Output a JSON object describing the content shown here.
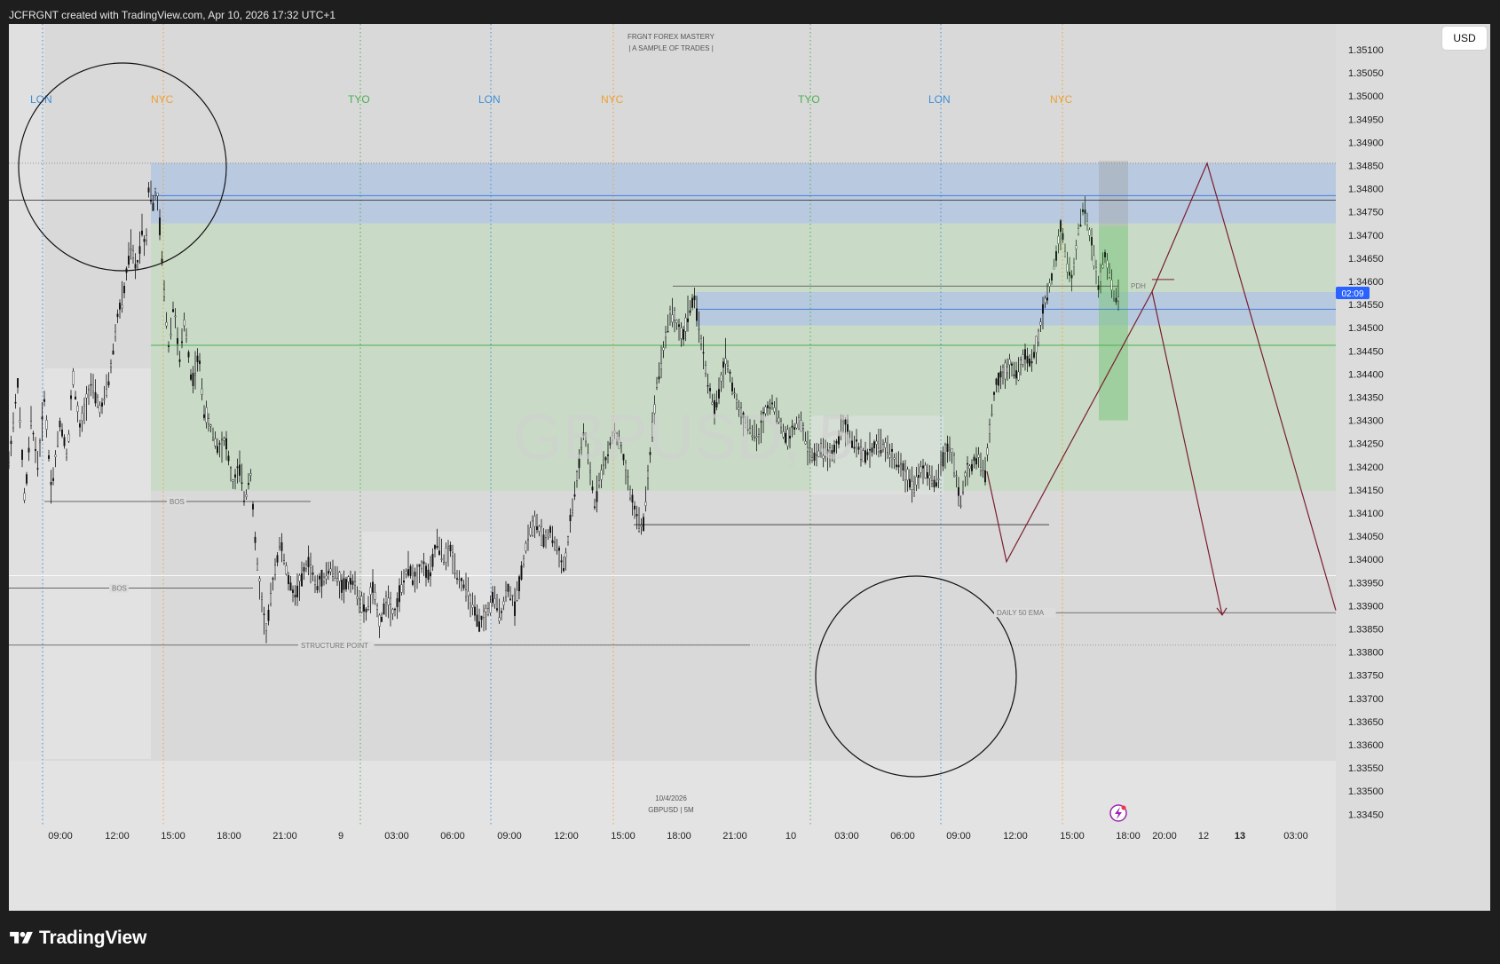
{
  "header": {
    "title": "JCFRGNT created with TradingView.com, Apr 10, 2026 17:32 UTC+1"
  },
  "currency": {
    "label": "USD"
  },
  "footer": {
    "brand": "TradingView"
  },
  "chart_data": {
    "type": "candlestick",
    "symbol_watermark": "GBPUSD, 5",
    "top_caption": [
      "FRGNT FOREX MASTERY",
      "|  A SAMPLE OF TRADES |"
    ],
    "bottom_caption": [
      "10/4/2026",
      "GBPUSD | 5M"
    ],
    "y_ticks": [
      "1.35100",
      "1.35050",
      "1.35000",
      "1.34950",
      "1.34900",
      "1.34850",
      "1.34800",
      "1.34750",
      "1.34700",
      "1.34650",
      "1.34600",
      "1.34550",
      "1.34500",
      "1.34450",
      "1.34400",
      "1.34350",
      "1.34300",
      "1.34250",
      "1.34200",
      "1.34150",
      "1.34100",
      "1.34050",
      "1.34000",
      "1.33950",
      "1.33900",
      "1.33850",
      "1.33800",
      "1.33750",
      "1.33700",
      "1.33650",
      "1.33600",
      "1.33550",
      "1.33500",
      "1.33450"
    ],
    "ylim": [
      1.3343,
      1.3511
    ],
    "price_marker": {
      "label": "02:09",
      "price": 1.34575,
      "color": "#2962ff"
    },
    "x_ticks": [
      {
        "label": "09:00",
        "bold": false
      },
      {
        "label": "12:00",
        "bold": false
      },
      {
        "label": "15:00",
        "bold": false
      },
      {
        "label": "18:00",
        "bold": false
      },
      {
        "label": "21:00",
        "bold": false
      },
      {
        "label": "9",
        "bold": false
      },
      {
        "label": "03:00",
        "bold": false
      },
      {
        "label": "06:00",
        "bold": false
      },
      {
        "label": "09:00",
        "bold": false
      },
      {
        "label": "12:00",
        "bold": false
      },
      {
        "label": "15:00",
        "bold": false
      },
      {
        "label": "18:00",
        "bold": false
      },
      {
        "label": "21:00",
        "bold": false
      },
      {
        "label": "10",
        "bold": false
      },
      {
        "label": "03:00",
        "bold": false
      },
      {
        "label": "06:00",
        "bold": false
      },
      {
        "label": "09:00",
        "bold": false
      },
      {
        "label": "12:00",
        "bold": false
      },
      {
        "label": "15:00",
        "bold": false
      },
      {
        "label": "18:00",
        "bold": false
      },
      {
        "label": "20:00",
        "bold": false
      },
      {
        "label": "12",
        "bold": false
      },
      {
        "label": "13",
        "bold": true
      },
      {
        "label": "03:00",
        "bold": false
      }
    ],
    "sessions": [
      {
        "label": "LON",
        "color": "#3d8fd6"
      },
      {
        "label": "NYC",
        "color": "#f0a030"
      },
      {
        "label": "TYO",
        "color": "#4caf50"
      },
      {
        "label": "LON",
        "color": "#3d8fd6"
      },
      {
        "label": "NYC",
        "color": "#f0a030"
      },
      {
        "label": "TYO",
        "color": "#4caf50"
      },
      {
        "label": "LON",
        "color": "#3d8fd6"
      },
      {
        "label": "NYC",
        "color": "#f0a030"
      }
    ],
    "annotations": [
      {
        "label": "BOS",
        "price": 1.34125
      },
      {
        "label": "BOS",
        "price": 1.33938
      },
      {
        "label": "STRUCTURE POINT",
        "price": 1.33815
      },
      {
        "label": "PDH",
        "price": 1.3459
      },
      {
        "label": "DAILY 50 EMA",
        "price": 1.33885
      }
    ],
    "zones": [
      {
        "name": "supply-zone",
        "top": 1.34855,
        "bottom": 1.34725,
        "color": "#b5c7e0"
      },
      {
        "name": "profit-zone",
        "top": 1.34725,
        "bottom": 1.34148,
        "color": "#c5dbc3"
      },
      {
        "name": "demand-zone",
        "top": 1.34577,
        "bottom": 1.34505,
        "color": "#b5c7e0"
      }
    ],
    "projection": {
      "color": "#7a1e2e",
      "path_prices": [
        1.3419,
        1.33995,
        1.34578,
        1.34855,
        1.3389
      ],
      "arrow_prices": [
        1.34578,
        1.3388
      ]
    },
    "price_path": [
      [
        0,
        1.3421
      ],
      [
        10,
        1.3438
      ],
      [
        18,
        1.3412
      ],
      [
        25,
        1.343
      ],
      [
        33,
        1.342
      ],
      [
        40,
        1.3435
      ],
      [
        48,
        1.3415
      ],
      [
        58,
        1.343
      ],
      [
        66,
        1.3422
      ],
      [
        72,
        1.344
      ],
      [
        80,
        1.3428
      ],
      [
        92,
        1.3438
      ],
      [
        104,
        1.3432
      ],
      [
        114,
        1.344
      ],
      [
        122,
        1.3452
      ],
      [
        130,
        1.3458
      ],
      [
        137,
        1.3468
      ],
      [
        144,
        1.3462
      ],
      [
        150,
        1.3472
      ],
      [
        154,
        1.3466
      ],
      [
        158,
        1.3482
      ],
      [
        162,
        1.3476
      ],
      [
        166,
        1.348
      ],
      [
        170,
        1.3472
      ],
      [
        174,
        1.346
      ],
      [
        180,
        1.3446
      ],
      [
        186,
        1.3456
      ],
      [
        192,
        1.3442
      ],
      [
        198,
        1.3452
      ],
      [
        206,
        1.3438
      ],
      [
        214,
        1.3444
      ],
      [
        220,
        1.3432
      ],
      [
        228,
        1.3428
      ],
      [
        236,
        1.3424
      ],
      [
        244,
        1.3426
      ],
      [
        252,
        1.3416
      ],
      [
        260,
        1.342
      ],
      [
        266,
        1.3412
      ],
      [
        272,
        1.342
      ],
      [
        278,
        1.3402
      ],
      [
        284,
        1.3392
      ],
      [
        290,
        1.3384
      ],
      [
        298,
        1.3396
      ],
      [
        306,
        1.3404
      ],
      [
        314,
        1.3396
      ],
      [
        322,
        1.3392
      ],
      [
        330,
        1.3396
      ],
      [
        338,
        1.34
      ],
      [
        346,
        1.3394
      ],
      [
        354,
        1.3396
      ],
      [
        362,
        1.3398
      ],
      [
        370,
        1.3396
      ],
      [
        378,
        1.3394
      ],
      [
        386,
        1.3396
      ],
      [
        394,
        1.3392
      ],
      [
        402,
        1.3388
      ],
      [
        410,
        1.3394
      ],
      [
        418,
        1.3386
      ],
      [
        426,
        1.3392
      ],
      [
        434,
        1.3388
      ],
      [
        442,
        1.3394
      ],
      [
        450,
        1.3398
      ],
      [
        458,
        1.3396
      ],
      [
        466,
        1.3399
      ],
      [
        474,
        1.3396
      ],
      [
        482,
        1.3404
      ],
      [
        490,
        1.34
      ],
      [
        498,
        1.3402
      ],
      [
        506,
        1.3396
      ],
      [
        514,
        1.3394
      ],
      [
        522,
        1.339
      ],
      [
        530,
        1.3386
      ],
      [
        538,
        1.3388
      ],
      [
        546,
        1.3392
      ],
      [
        554,
        1.3388
      ],
      [
        562,
        1.3394
      ],
      [
        570,
        1.339
      ],
      [
        578,
        1.3398
      ],
      [
        586,
        1.3406
      ],
      [
        594,
        1.3408
      ],
      [
        602,
        1.3404
      ],
      [
        610,
        1.3406
      ],
      [
        618,
        1.3402
      ],
      [
        626,
        1.3398
      ],
      [
        634,
        1.341
      ],
      [
        642,
        1.342
      ],
      [
        648,
        1.3428
      ],
      [
        654,
        1.342
      ],
      [
        660,
        1.3412
      ],
      [
        666,
        1.3418
      ],
      [
        674,
        1.3422
      ],
      [
        682,
        1.3428
      ],
      [
        690,
        1.3424
      ],
      [
        698,
        1.3416
      ],
      [
        706,
        1.341
      ],
      [
        714,
        1.3406
      ],
      [
        722,
        1.3422
      ],
      [
        730,
        1.3438
      ],
      [
        738,
        1.3446
      ],
      [
        746,
        1.3454
      ],
      [
        754,
        1.345
      ],
      [
        760,
        1.3448
      ],
      [
        766,
        1.3454
      ],
      [
        772,
        1.3456
      ],
      [
        778,
        1.345
      ],
      [
        784,
        1.3442
      ],
      [
        790,
        1.3436
      ],
      [
        796,
        1.3432
      ],
      [
        802,
        1.3438
      ],
      [
        808,
        1.3444
      ],
      [
        814,
        1.3438
      ],
      [
        820,
        1.3434
      ],
      [
        828,
        1.343
      ],
      [
        836,
        1.3428
      ],
      [
        844,
        1.3426
      ],
      [
        852,
        1.3432
      ],
      [
        860,
        1.3434
      ],
      [
        868,
        1.343
      ],
      [
        876,
        1.3426
      ],
      [
        884,
        1.3428
      ],
      [
        892,
        1.343
      ],
      [
        900,
        1.3424
      ],
      [
        908,
        1.3422
      ],
      [
        916,
        1.3424
      ],
      [
        924,
        1.3422
      ],
      [
        932,
        1.3424
      ],
      [
        940,
        1.343
      ],
      [
        948,
        1.3426
      ],
      [
        956,
        1.3424
      ],
      [
        964,
        1.3422
      ],
      [
        972,
        1.3424
      ],
      [
        980,
        1.3425
      ],
      [
        988,
        1.3424
      ],
      [
        996,
        1.3422
      ],
      [
        1004,
        1.342
      ],
      [
        1012,
        1.3418
      ],
      [
        1020,
        1.3416
      ],
      [
        1028,
        1.342
      ],
      [
        1036,
        1.3418
      ],
      [
        1044,
        1.3416
      ],
      [
        1052,
        1.3422
      ],
      [
        1060,
        1.3424
      ],
      [
        1066,
        1.342
      ],
      [
        1072,
        1.3412
      ],
      [
        1078,
        1.3418
      ],
      [
        1084,
        1.342
      ],
      [
        1092,
        1.3422
      ],
      [
        1100,
        1.3418
      ],
      [
        1106,
        1.343
      ],
      [
        1112,
        1.3438
      ],
      [
        1120,
        1.344
      ],
      [
        1128,
        1.3442
      ],
      [
        1136,
        1.344
      ],
      [
        1144,
        1.3444
      ],
      [
        1152,
        1.3442
      ],
      [
        1160,
        1.3448
      ],
      [
        1168,
        1.3456
      ],
      [
        1174,
        1.346
      ],
      [
        1180,
        1.3466
      ],
      [
        1186,
        1.3472
      ],
      [
        1192,
        1.3464
      ],
      [
        1198,
        1.346
      ],
      [
        1204,
        1.347
      ],
      [
        1210,
        1.3476
      ],
      [
        1216,
        1.3472
      ],
      [
        1222,
        1.3466
      ],
      [
        1228,
        1.3458
      ],
      [
        1234,
        1.3466
      ],
      [
        1240,
        1.3462
      ],
      [
        1246,
        1.3456
      ],
      [
        1252,
        1.3458
      ]
    ]
  }
}
